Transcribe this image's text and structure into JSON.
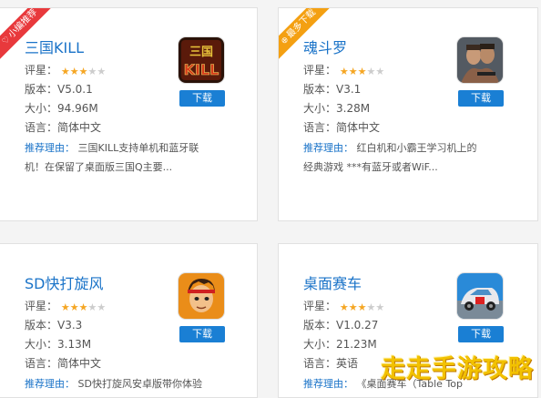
{
  "labels": {
    "rating": "评星：",
    "version": "版本：",
    "size": "大小：",
    "language": "语言：",
    "reason": "推荐理由：",
    "download": "下载"
  },
  "apps": [
    {
      "ribbon": "小编推荐",
      "ribbon_color": "#e8393c",
      "ribbon_icon": "thumb-icon",
      "title": "三国KILL",
      "rating": 3,
      "version": "V5.0.1",
      "size": "94.96M",
      "language": "简体中文",
      "reason_1": "三国KILL支持单机和蓝牙联",
      "reason_2": "机！在保留了桌面版三国Q主要...",
      "icon_text": "三国KILL"
    },
    {
      "ribbon": "最多下载",
      "ribbon_color": "#f4a012",
      "ribbon_icon": "download-circle-icon",
      "title": "魂斗罗",
      "rating": 3,
      "version": "V3.1",
      "size": "3.28M",
      "language": "简体中文",
      "reason_1": "红白机和小霸王学习机上的",
      "reason_2": "经典游戏 ***有蓝牙或者WiF..."
    },
    {
      "title": "SD快打旋风",
      "rating": 3,
      "version": "V3.3",
      "size": "3.13M",
      "language": "简体中文",
      "reason_1": "SD快打旋风安卓版带你体验"
    },
    {
      "title": "桌面赛车",
      "rating": 3,
      "version": "V1.0.27",
      "size": "21.23M",
      "language": "英语",
      "reason_1": "《桌面赛车（Table Top"
    }
  ],
  "watermark": "走走手游攻略"
}
